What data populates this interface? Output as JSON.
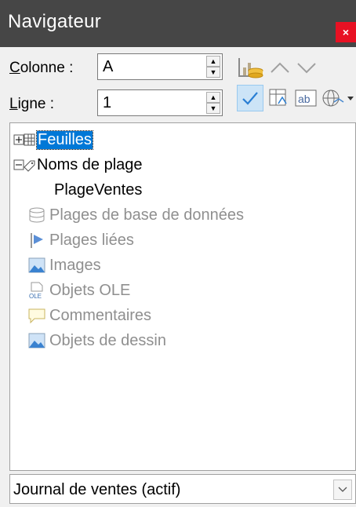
{
  "window": {
    "title": "Navigateur",
    "close_glyph": "×"
  },
  "controls": {
    "column_label_u": "C",
    "column_label_rest": "olonne :",
    "column_value": "A",
    "row_label_u": "L",
    "row_label_rest": "igne :",
    "row_value": "1"
  },
  "toolbar": {
    "icons": [
      "data-range-icon",
      "previous-icon",
      "next-icon",
      "content-toggle-icon",
      "scenarios-icon",
      "drag-mode-icon",
      "document-select-dropdown"
    ]
  },
  "tree": {
    "sheets": "Feuilles",
    "range_names": "Noms de plage",
    "range_name_child": "PlageVentes",
    "database_ranges": "Plages de base de données",
    "linked_areas": "Plages liées",
    "images": "Images",
    "ole_objects": "Objets OLE",
    "comments": "Commentaires",
    "drawing_objects": "Objets de dessin"
  },
  "document_select": {
    "value": "Journal de ventes (actif)"
  },
  "colors": {
    "selection": "#0078d7",
    "disabled_text": "#8f8f8f",
    "titlebar": "#464646",
    "close": "#e81123"
  }
}
